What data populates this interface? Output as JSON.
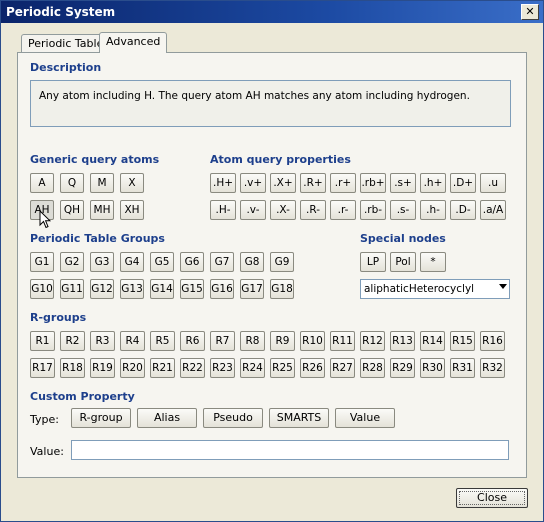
{
  "window": {
    "title": "Periodic System",
    "close_glyph": "✕"
  },
  "tabs": [
    {
      "label": "Periodic Table"
    },
    {
      "label": "Advanced"
    }
  ],
  "description": {
    "heading": "Description",
    "text": "Any atom including H. The query atom AH matches any atom including hydrogen."
  },
  "generic": {
    "heading": "Generic query atoms",
    "row1": [
      "A",
      "Q",
      "M",
      "X"
    ],
    "row2": [
      "AH",
      "QH",
      "MH",
      "XH"
    ],
    "selected": "AH"
  },
  "atomprops": {
    "heading": "Atom query properties",
    "row1": [
      ".H+",
      ".v+",
      ".X+",
      ".R+",
      ".r+",
      ".rb+",
      ".s+",
      ".h+",
      ".D+",
      ".u"
    ],
    "row2": [
      ".H-",
      ".v-",
      ".X-",
      ".R-",
      ".r-",
      ".rb-",
      ".s-",
      ".h-",
      ".D-",
      ".a/A"
    ]
  },
  "groups": {
    "heading": "Periodic Table Groups",
    "row1": [
      "G1",
      "G2",
      "G3",
      "G4",
      "G5",
      "G6",
      "G7",
      "G8",
      "G9"
    ],
    "row2": [
      "G10",
      "G11",
      "G12",
      "G13",
      "G14",
      "G15",
      "G16",
      "G17",
      "G18"
    ]
  },
  "special": {
    "heading": "Special nodes",
    "buttons": [
      "LP",
      "Pol",
      "*"
    ],
    "select_value": "aliphaticHeterocyclyl"
  },
  "rgroups": {
    "heading": "R-groups",
    "row1": [
      "R1",
      "R2",
      "R3",
      "R4",
      "R5",
      "R6",
      "R7",
      "R8",
      "R9",
      "R10",
      "R11",
      "R12",
      "R13",
      "R14",
      "R15",
      "R16"
    ],
    "row2": [
      "R17",
      "R18",
      "R19",
      "R20",
      "R21",
      "R22",
      "R23",
      "R24",
      "R25",
      "R26",
      "R27",
      "R28",
      "R29",
      "R30",
      "R31",
      "R32"
    ]
  },
  "custom": {
    "heading": "Custom Property",
    "type_label": "Type:",
    "types": [
      "R-group",
      "Alias",
      "Pseudo",
      "SMARTS",
      "Value"
    ],
    "value_label": "Value:",
    "value": ""
  },
  "footer": {
    "close_label": "Close"
  }
}
